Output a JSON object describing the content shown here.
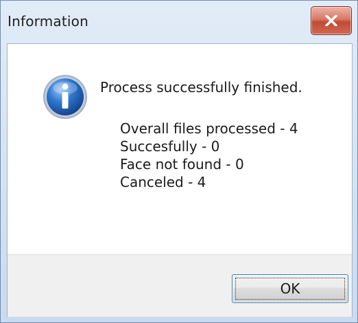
{
  "window": {
    "title": "Information",
    "close_icon": "close-icon"
  },
  "content": {
    "icon": "info-icon",
    "message": "Process successfully finished.",
    "details": [
      "Overall files processed - 4",
      "Succesfully - 0",
      "Face not found - 0",
      "Canceled - 4"
    ]
  },
  "buttons": {
    "ok_label": "OK"
  },
  "colors": {
    "close_button": "#c9503a",
    "info_icon": "#1d5fb6",
    "ok_border": "#3c7fb1"
  }
}
